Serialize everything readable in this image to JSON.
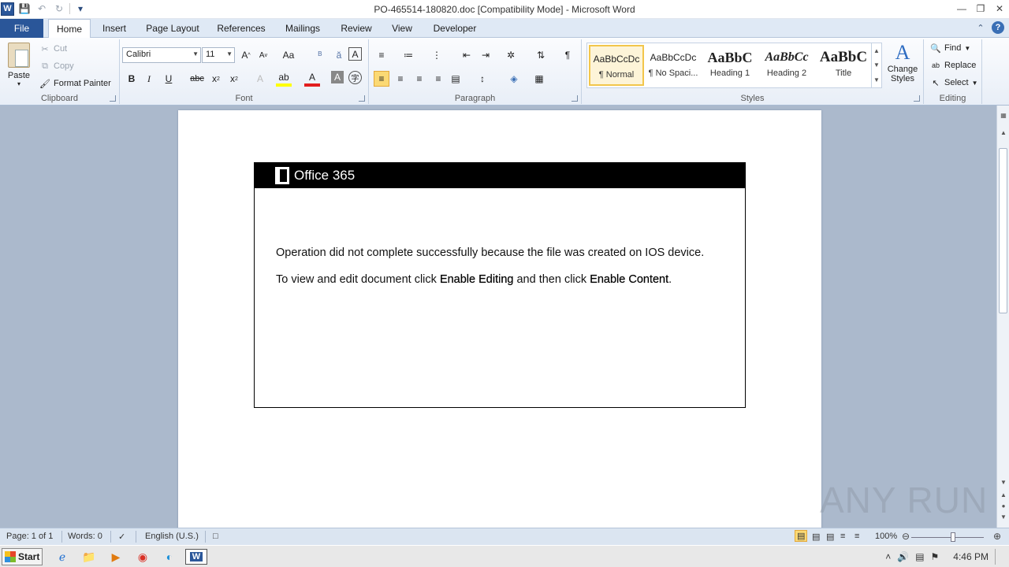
{
  "window": {
    "title": "PO-465514-180820.doc [Compatibility Mode]  -  Microsoft Word",
    "app_icon_letter": "W"
  },
  "tabs": [
    "File",
    "Home",
    "Insert",
    "Page Layout",
    "References",
    "Mailings",
    "Review",
    "View",
    "Developer"
  ],
  "ribbon": {
    "clipboard": {
      "label": "Clipboard",
      "paste": "Paste",
      "cut": "Cut",
      "copy": "Copy",
      "format_painter": "Format Painter"
    },
    "font": {
      "label": "Font",
      "font_name": "Calibri",
      "font_size": "11"
    },
    "paragraph": {
      "label": "Paragraph"
    },
    "styles": {
      "label": "Styles",
      "items": [
        {
          "preview": "AaBbCcDc",
          "name": "¶ Normal"
        },
        {
          "preview": "AaBbCcDc",
          "name": "¶ No Spaci..."
        },
        {
          "preview": "AaBbC",
          "name": "Heading 1"
        },
        {
          "preview": "AaBbCc",
          "name": "Heading 2"
        },
        {
          "preview": "AaBbC",
          "name": "Title"
        }
      ],
      "change_styles": "Change Styles"
    },
    "editing": {
      "label": "Editing",
      "find": "Find",
      "replace": "Replace",
      "select": "Select"
    }
  },
  "document": {
    "banner_brand": "Office 365",
    "line1": "Operation did not complete successfully because the file was created on IOS device.",
    "line2_prefix": "To view and edit document click ",
    "line2_bold1": "Enable Editing",
    "line2_mid": " and then click ",
    "line2_bold2": "Enable Content",
    "line2_suffix": "."
  },
  "watermark": "ANY RUN",
  "status": {
    "page": "Page: 1 of 1",
    "words": "Words: 0",
    "language": "English (U.S.)",
    "zoom": "100%"
  },
  "taskbar": {
    "start": "Start",
    "clock": "4:46 PM"
  }
}
